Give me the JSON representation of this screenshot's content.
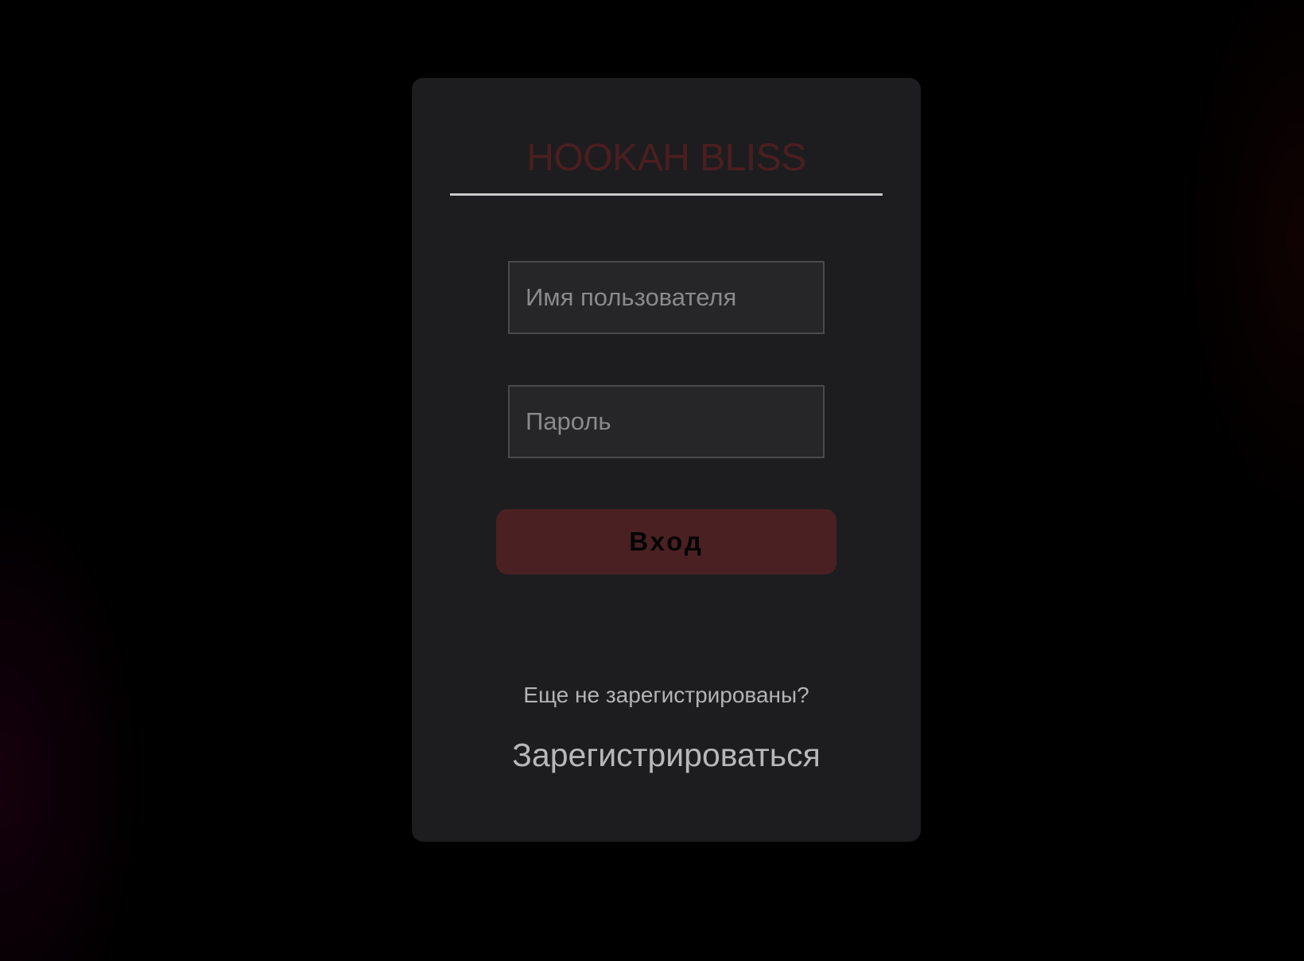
{
  "brand": {
    "title": "HOOKAH BLISS",
    "color": "#4c1e20"
  },
  "form": {
    "username": {
      "placeholder": "Имя пользователя",
      "value": ""
    },
    "password": {
      "placeholder": "Пароль",
      "value": ""
    },
    "login_label": "Вход",
    "login_color": "#4a2023"
  },
  "footer": {
    "prompt": "Еще не зарегистрированы?",
    "register_label": "Зарегистрироваться"
  }
}
